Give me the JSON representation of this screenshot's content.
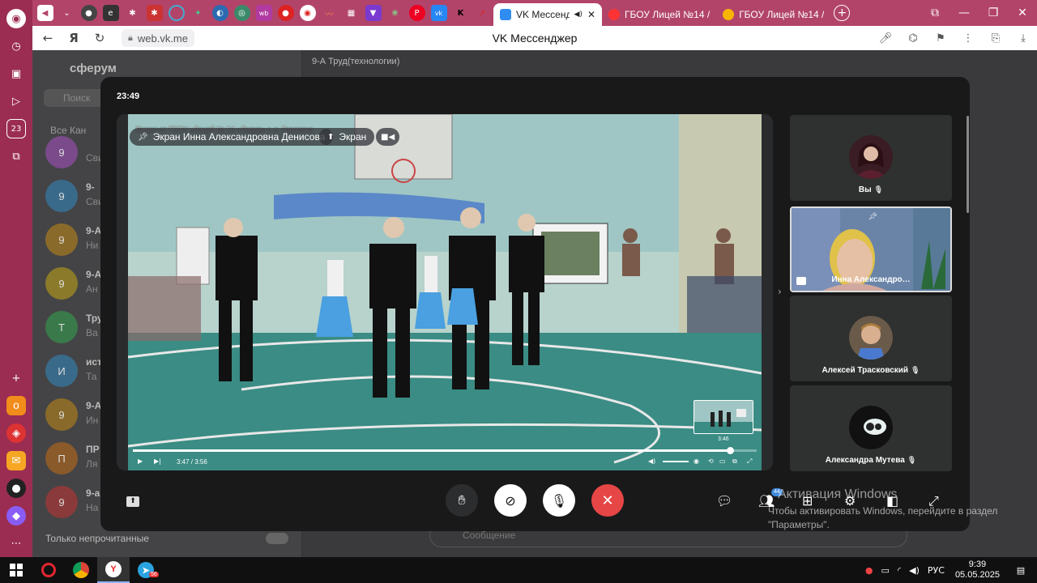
{
  "browser": {
    "tabs": [
      {
        "label": "VK Мессендж",
        "active": true
      },
      {
        "label": "ГБОУ Лицей №14 /",
        "active": false
      },
      {
        "label": "ГБОУ Лицей №14 /",
        "active": false
      }
    ],
    "url": "web.vk.me",
    "page_title": "VK Мессенджер",
    "nav_back": "←",
    "nav_home": "Я",
    "nav_reload": "↻"
  },
  "background": {
    "brand": "сферум",
    "search_placeholder": "Поиск",
    "filters": "Все   Кан",
    "chats": [
      {
        "initial": "9",
        "name": "",
        "preview": "Сви",
        "color": "#7a4a8a"
      },
      {
        "initial": "9",
        "name": "9-",
        "preview": "Сви",
        "color": "#3a6a8a"
      },
      {
        "initial": "9",
        "name": "9-А",
        "preview": "Ни",
        "color": "#8a6a2a"
      },
      {
        "initial": "9",
        "name": "9-А",
        "preview": "Ан",
        "color": "#8a7a2a"
      },
      {
        "initial": "Т",
        "name": "Тру",
        "preview": "Ва",
        "color": "#3a7a4a"
      },
      {
        "initial": "И",
        "name": "ист",
        "preview": "Та",
        "color": "#3a6a8a"
      },
      {
        "initial": "9",
        "name": "9-А",
        "preview": "Ин",
        "color": "#8a6a2a"
      },
      {
        "initial": "П",
        "name": "ПР",
        "preview": "Ля",
        "color": "#8a5a2a"
      },
      {
        "initial": "9",
        "name": "9-а",
        "preview": "На",
        "color": "#8a3a3a"
      }
    ],
    "unread_only": "Только непрочитанные",
    "chat_header": "9-А Труд(технологии)",
    "message_placeholder": "Сообщение"
  },
  "call": {
    "timer": "23:49",
    "screen_caption": "Видео от ГБОУ «Лицей № 14 «Лидер» г. о. Горловка",
    "pin_label": "Экран Инна Александровна Денисова",
    "screen_label": "Экран",
    "player": {
      "current_time": "3:47",
      "duration": "3:56",
      "time_display": "3:47 / 3:56",
      "thumb_time": "3:46",
      "progress": 0.957
    },
    "participants": [
      {
        "name": "Вы",
        "muted": true,
        "pinned": false,
        "avatar": "#6a3040"
      },
      {
        "name": "Инна Александро…",
        "muted": false,
        "pinned": true,
        "avatar": "#c9a27a"
      },
      {
        "name": "Алексей Трасковский",
        "muted": true,
        "pinned": false,
        "avatar": "#a87a4a"
      },
      {
        "name": "Александра Мутева",
        "muted": true,
        "pinned": false,
        "avatar": "#222"
      }
    ],
    "controls": {
      "participants_badge": "44",
      "hangup_color": "#e64646"
    }
  },
  "watermark": {
    "title": "Активация Windows",
    "line1": "Чтобы активировать Windows, перейдите в раздел",
    "line2": "\"Параметры\"."
  },
  "taskbar": {
    "language": "РУС",
    "time": "9:39",
    "date": "05.05.2025",
    "telegram_badge": "56"
  }
}
